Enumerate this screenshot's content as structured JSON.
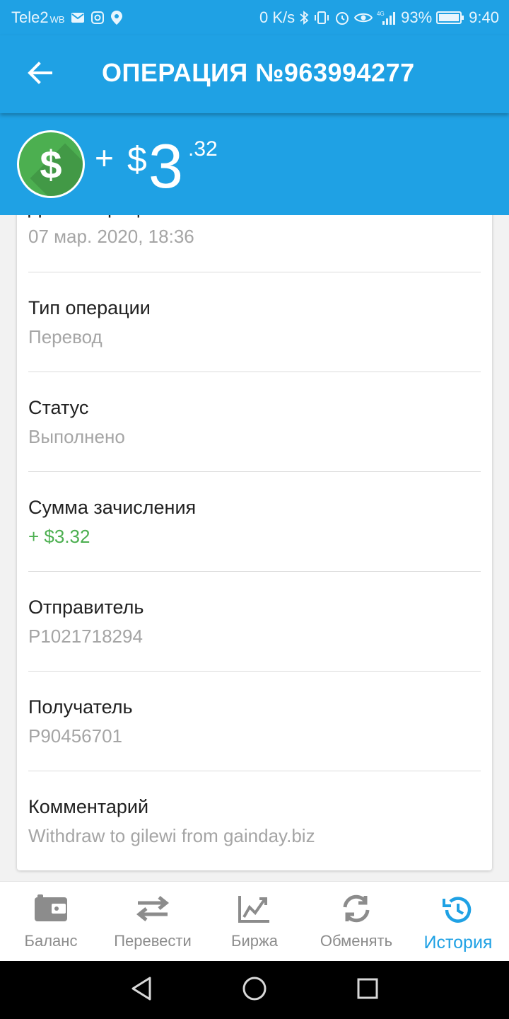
{
  "status_bar": {
    "carrier": "Tele2",
    "carrier_sub": "WB",
    "network_speed": "0 K/s",
    "network_type": "4G",
    "battery": "93%",
    "time": "9:40",
    "icons": [
      "mail-icon",
      "instagram-icon",
      "location-icon",
      "bluetooth-icon",
      "vibrate-icon",
      "alarm-icon",
      "eye-icon",
      "signal-icon",
      "battery-icon"
    ]
  },
  "header": {
    "title": "ОПЕРАЦИЯ №963994277",
    "back_icon": "arrow-left-icon"
  },
  "amount": {
    "sign": "+",
    "currency": "$",
    "integer": "3",
    "cents": ".32",
    "icon": "dollar-coin-icon"
  },
  "details": [
    {
      "label": "Дата операции",
      "value": "07 мар. 2020, 18:36"
    },
    {
      "label": "Тип операции",
      "value": "Перевод"
    },
    {
      "label": "Статус",
      "value": "Выполнено"
    },
    {
      "label": "Сумма зачисления",
      "value": "+ $3.32",
      "value_color": "#4caf50"
    },
    {
      "label": "Отправитель",
      "value": "P1021718294"
    },
    {
      "label": "Получатель",
      "value": "P90456701"
    },
    {
      "label": "Комментарий",
      "value": "Withdraw to gilewi from gainday.biz"
    }
  ],
  "bottom_nav": {
    "items": [
      {
        "label": "Баланс",
        "icon": "wallet-icon"
      },
      {
        "label": "Перевести",
        "icon": "transfer-arrows-icon"
      },
      {
        "label": "Биржа",
        "icon": "chart-icon"
      },
      {
        "label": "Обменять",
        "icon": "refresh-icon"
      },
      {
        "label": "История",
        "icon": "history-icon"
      }
    ],
    "active": "История"
  },
  "colors": {
    "primary": "#1fa1e4",
    "accent_green": "#4caf50",
    "muted_text": "#a5a5a5"
  }
}
